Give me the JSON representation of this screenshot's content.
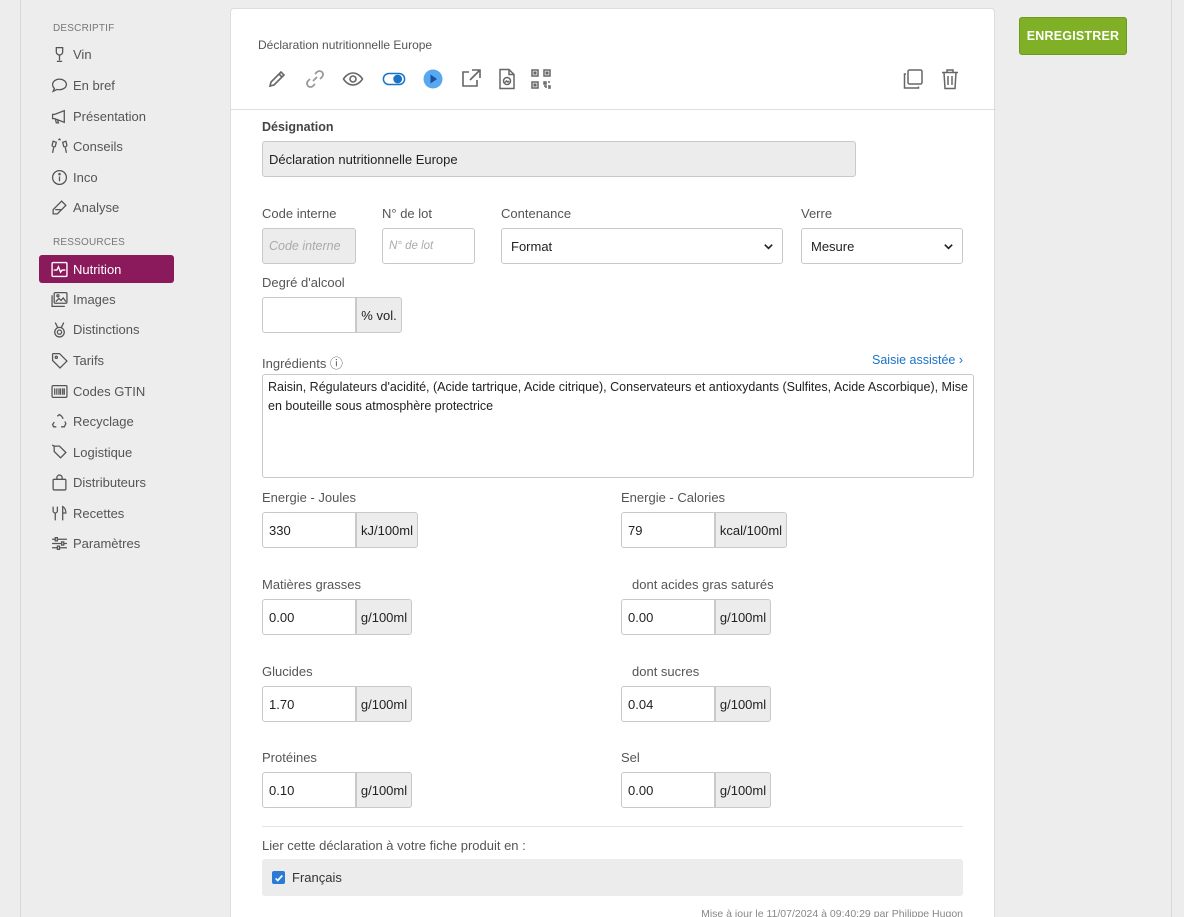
{
  "sidebar": {
    "section_descriptif": "DESCRIPTIF",
    "section_ressources": "RESSOURCES",
    "items": [
      {
        "label": "Vin",
        "icon": "wine-glass-icon"
      },
      {
        "label": "En bref",
        "icon": "speech-bubble-icon"
      },
      {
        "label": "Présentation",
        "icon": "megaphone-icon"
      },
      {
        "label": "Conseils",
        "icon": "toast-glasses-icon"
      },
      {
        "label": "Inco",
        "icon": "info-circle-icon"
      },
      {
        "label": "Analyse",
        "icon": "pipette-icon"
      },
      {
        "label": "Nutrition",
        "icon": "heartbeat-icon",
        "active": true
      },
      {
        "label": "Images",
        "icon": "images-icon"
      },
      {
        "label": "Distinctions",
        "icon": "medal-icon"
      },
      {
        "label": "Tarifs",
        "icon": "price-tag-icon"
      },
      {
        "label": "Codes GTIN",
        "icon": "barcode-icon"
      },
      {
        "label": "Recyclage",
        "icon": "recycle-icon"
      },
      {
        "label": "Logistique",
        "icon": "label-tag-icon"
      },
      {
        "label": "Distributeurs",
        "icon": "shopping-bag-icon"
      },
      {
        "label": "Recettes",
        "icon": "fork-knife-icon"
      },
      {
        "label": "Paramètres",
        "icon": "sliders-icon"
      }
    ]
  },
  "header": {
    "title": "Déclaration nutritionnelle Europe",
    "save_label": "ENREGISTRER"
  },
  "colors": {
    "accent_active": "#8b1a5c",
    "save_button": "#7fb025",
    "link": "#1a73c8"
  },
  "form": {
    "designation_label": "Désignation",
    "designation_value": "Déclaration nutritionnelle Europe",
    "code_interne_label": "Code interne",
    "code_interne_placeholder": "Code interne",
    "lot_label": "N° de lot",
    "lot_placeholder": "N° de lot",
    "contenance_label": "Contenance",
    "contenance_value": "Format",
    "verre_label": "Verre",
    "verre_value": "Mesure",
    "alcool_label": "Degré d'alcool",
    "alcool_value": "",
    "alcool_unit": "% vol.",
    "ingredients_label": "Ingrédients ⓘ",
    "saisie_link": "Saisie assistée ›",
    "ingredients_value": "Raisin, Régulateurs d'acidité, (Acide tartrique, Acide citrique), Conservateurs et antioxydants (Sulfites, Acide Ascorbique), Mise en bouteille sous atmosphère protectrice",
    "energie_joules_label": "Energie - Joules",
    "energie_joules_value": "330",
    "energie_joules_unit": "kJ/100ml",
    "energie_cal_label": "Energie - Calories",
    "energie_cal_value": "79",
    "energie_cal_unit": "kcal/100ml",
    "mg_label": "Matières grasses",
    "mg_value": "0.00",
    "mg_unit": "g/100ml",
    "ags_label": "dont acides gras saturés",
    "ags_value": "0.00",
    "ags_unit": "g/100ml",
    "glucides_label": "Glucides",
    "glucides_value": "1.70",
    "glucides_unit": "g/100ml",
    "sucres_label": "dont sucres",
    "sucres_value": "0.04",
    "sucres_unit": "g/100ml",
    "proteines_label": "Protéines",
    "proteines_value": "0.10",
    "proteines_unit": "g/100ml",
    "sel_label": "Sel",
    "sel_value": "0.00",
    "sel_unit": "g/100ml",
    "link_label": "Lier cette déclaration à votre fiche produit en :",
    "lang_fr": "Français",
    "footer": "Mise à jour le 11/07/2024 à 09:40:29 par Philippe Hugon"
  }
}
